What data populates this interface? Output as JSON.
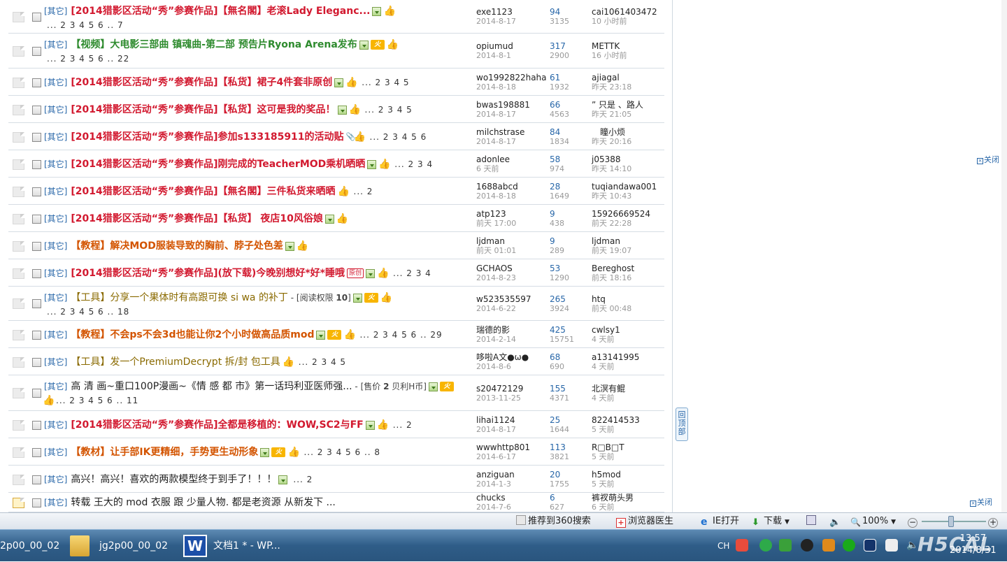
{
  "forum": {
    "threads": [
      {
        "cat": "[其它]",
        "title": "[2014猎影区活动“秀”参赛作品]【無名閣】老滚Lady Eleganc...",
        "color": "red",
        "icons": [
          "img",
          "thumb"
        ],
        "suffix": "",
        "pages_inline": "",
        "pages_line2": "... 2 3 4 5 6 .. 7",
        "author": "exe1123",
        "date": "2014-8-17",
        "replies": "94",
        "views": "3135",
        "last_user": "cai1061403472",
        "last_time": "10 小时前"
      },
      {
        "cat": "[其它]",
        "title": "【视频】大电影三部曲 镇魂曲-第二部 预告片Ryona Arena发布",
        "color": "green",
        "icons": [
          "img",
          "hot",
          "thumb"
        ],
        "suffix": "",
        "pages_inline": "",
        "pages_line2": "... 2 3 4 5 6 .. 22",
        "author": "opiumud",
        "date": "2014-8-1",
        "replies": "317",
        "views": "2900",
        "last_user": "METTK",
        "last_time": "16 小时前"
      },
      {
        "cat": "[其它]",
        "title": "[2014猎影区活动“秀”参赛作品]【私货】裙子4件套非原创",
        "color": "red",
        "icons": [
          "img",
          "thumb"
        ],
        "suffix": "",
        "pages_inline": "... 2 3 4 5",
        "pages_line2": "",
        "author": "wo1992822haha",
        "date": "2014-8-18",
        "replies": "61",
        "views": "1932",
        "last_user": "ajiagal",
        "last_time": "昨天 23:18"
      },
      {
        "cat": "[其它]",
        "title": "[2014猎影区活动“秀”参赛作品]【私货】这可是我的奖品！",
        "color": "red",
        "icons": [
          "img",
          "thumb"
        ],
        "suffix": "",
        "pages_inline": "... 2 3 4 5",
        "pages_line2": "",
        "author": "bwas198881",
        "date": "2014-8-17",
        "replies": "66",
        "views": "4563",
        "last_user": "” 只是 、路人",
        "last_time": "昨天 21:05"
      },
      {
        "cat": "[其它]",
        "title": "[2014猎影区活动“秀”参赛作品]参加s133185911的活动贴",
        "color": "red",
        "icons": [
          "clip",
          "thumb"
        ],
        "suffix": "",
        "pages_inline": "... 2 3 4 5 6",
        "pages_line2": "",
        "author": "milchstrase",
        "date": "2014-8-17",
        "replies": "84",
        "views": "1834",
        "last_user": "　瞳小烦",
        "last_time": "昨天 20:16"
      },
      {
        "cat": "[其它]",
        "title": "[2014猎影区活动“秀”参赛作品]刚完成的TeacherMOD乘机晒晒",
        "color": "red",
        "icons": [
          "img",
          "thumb"
        ],
        "suffix": "",
        "pages_inline": "... 2 3 4",
        "pages_line2": "",
        "author": "adonlee",
        "date": "6 天前",
        "replies": "58",
        "views": "974",
        "last_user": "j05388",
        "last_time": "昨天 14:10"
      },
      {
        "cat": "[其它]",
        "title": "[2014猎影区活动“秀”参赛作品]【無名閣】三件私货来晒晒",
        "color": "red",
        "icons": [
          "thumb"
        ],
        "suffix": "",
        "pages_inline": "... 2",
        "pages_line2": "",
        "author": "1688abcd",
        "date": "2014-8-18",
        "replies": "28",
        "views": "1649",
        "last_user": "tuqiandawa001",
        "last_time": "昨天 10:43"
      },
      {
        "cat": "[其它]",
        "title": "[2014猎影区活动“秀”参赛作品]【私货】 夜店10风俗娘",
        "color": "red",
        "icons": [
          "img",
          "thumb"
        ],
        "suffix": "",
        "pages_inline": "",
        "pages_line2": "",
        "author": "atp123",
        "date": "前天 17:00",
        "replies": "9",
        "views": "438",
        "last_user": "15926669524",
        "last_time": "前天 22:28"
      },
      {
        "cat": "[其它]",
        "title": "【教程】解决MOD服装导致的胸前、脖子处色差",
        "color": "orange",
        "icons": [
          "img",
          "thumb"
        ],
        "suffix": "",
        "pages_inline": "",
        "pages_line2": "",
        "author": "ljdman",
        "date": "前天 01:01",
        "replies": "9",
        "views": "289",
        "last_user": "ljdman",
        "last_time": "前天 19:07"
      },
      {
        "cat": "[其它]",
        "title": "[2014猎影区活动“秀”参赛作品](放下载)今晚别想好*好*睡哦",
        "color": "red",
        "icons": [
          "orig",
          "img",
          "thumb"
        ],
        "orig_label": "原创",
        "suffix": "",
        "pages_inline": "... 2 3 4",
        "pages_line2": "",
        "author": "GCHAOS",
        "date": "2014-8-23",
        "replies": "53",
        "views": "1290",
        "last_user": "Bereghost",
        "last_time": "前天 18:16"
      },
      {
        "cat": "[其它]",
        "title": "【工具】分享一个果体时有高跟可换 si wa 的补丁",
        "color": "olive",
        "icons": [
          "img",
          "hot",
          "thumb"
        ],
        "suffix": " - [阅读权限 ",
        "suffix_bold": "10",
        "suffix_end": "]",
        "pages_inline": "",
        "pages_line2": "... 2 3 4 5 6 .. 18",
        "author": "w523535597",
        "date": "2014-6-22",
        "replies": "265",
        "views": "3924",
        "last_user": "htq",
        "last_time": "前天 00:48"
      },
      {
        "cat": "[其它]",
        "title": "【教程】不会ps不会3d也能让你2个小时做高品质mod",
        "color": "orange",
        "icons": [
          "img",
          "hot",
          "thumb"
        ],
        "suffix": "",
        "pages_inline": "... 2 3 4 5 6 .. 29",
        "pages_line2": "",
        "author": "瑞德的影",
        "date": "2014-2-14",
        "replies": "425",
        "views": "15751",
        "last_user": "cwlsy1",
        "last_time": "4 天前"
      },
      {
        "cat": "[其它]",
        "title": "【工具】发一个PremiumDecrypt 拆/封 包工具",
        "color": "olive",
        "icons": [
          "thumb"
        ],
        "suffix": "",
        "pages_inline": "... 2 3 4 5",
        "pages_line2": "",
        "author": "哆啦A文●ω●",
        "date": "2014-8-6",
        "replies": "68",
        "views": "690",
        "last_user": "a13141995",
        "last_time": "4 天前"
      },
      {
        "cat": "[其它]",
        "title": "高 清 画~重口100P漫画~《情 感 都 市》第一话玛利亚医师强...",
        "color": "plain",
        "icons": [
          "img",
          "hot"
        ],
        "suffix": " - [售价 ",
        "suffix_bold": "2",
        "suffix_end": " 贝利H币]",
        "pages_inline": "",
        "pages_line2": "... 2 3 4 5 6 .. 11",
        "line2_thumb": true,
        "author": "s20472129",
        "date": "2013-11-25",
        "replies": "155",
        "views": "4371",
        "last_user": "北溟有鲲",
        "last_time": "4 天前"
      },
      {
        "cat": "[其它]",
        "title": "[2014猎影区活动“秀”参赛作品]全都是移植的：WOW,SC2与FF",
        "color": "red",
        "icons": [
          "img",
          "thumb"
        ],
        "suffix": "",
        "pages_inline": "... 2",
        "pages_line2": "",
        "author": "lihai1124",
        "date": "2014-8-17",
        "replies": "25",
        "views": "1644",
        "last_user": "822414533",
        "last_time": "5 天前"
      },
      {
        "cat": "[其它]",
        "title": "【教材】让手部IK更精细，手势更生动形象",
        "color": "orange",
        "icons": [
          "img",
          "hot",
          "thumb"
        ],
        "suffix": "",
        "pages_inline": "... 2 3 4 5 6 .. 8",
        "pages_line2": "",
        "author": "wwwhttp801",
        "date": "2014-6-17",
        "replies": "113",
        "views": "3821",
        "last_user": "R□B□T",
        "last_time": "5 天前"
      },
      {
        "cat": "[其它]",
        "title": "高兴！高兴！喜欢的两款模型终于到手了！！！",
        "color": "plain",
        "icons": [
          "img"
        ],
        "suffix": "",
        "pages_inline": "... 2",
        "pages_line2": "",
        "author": "anziguan",
        "date": "2014-1-3",
        "replies": "20",
        "views": "1755",
        "last_user": "h5mod",
        "last_time": "5 天前"
      },
      {
        "cat": "[其它]",
        "title": "转载 王大的 mod 衣服 跟 少量人物. 都是老资源 从新发下 ...",
        "color": "plain",
        "icons": [],
        "suffix": "",
        "pages_inline": "",
        "pages_line2": "",
        "locked": true,
        "author": "chucks",
        "date": "2014-7-6",
        "replies": "6",
        "views": "627",
        "last_user": "裤衩萌头男",
        "last_time": "6 天前"
      }
    ],
    "back_to_top": "回顶部"
  },
  "ads": {
    "close_label_1": "关闭",
    "close_label_2": "关闭"
  },
  "statusbar": {
    "recommend_360": "推荐到360搜索",
    "browser_doctor": "浏览器医生",
    "ie_open": "IE打开",
    "download": "下载",
    "zoom": "100%"
  },
  "taskbar": {
    "item1": "2p00_00_02",
    "item2": "jg2p00_00_02",
    "item3": "文档1 * - WP...",
    "ime": "CH",
    "clock_time": "13:57",
    "clock_date": "2014/8/31",
    "watermark": "H5CAL"
  }
}
